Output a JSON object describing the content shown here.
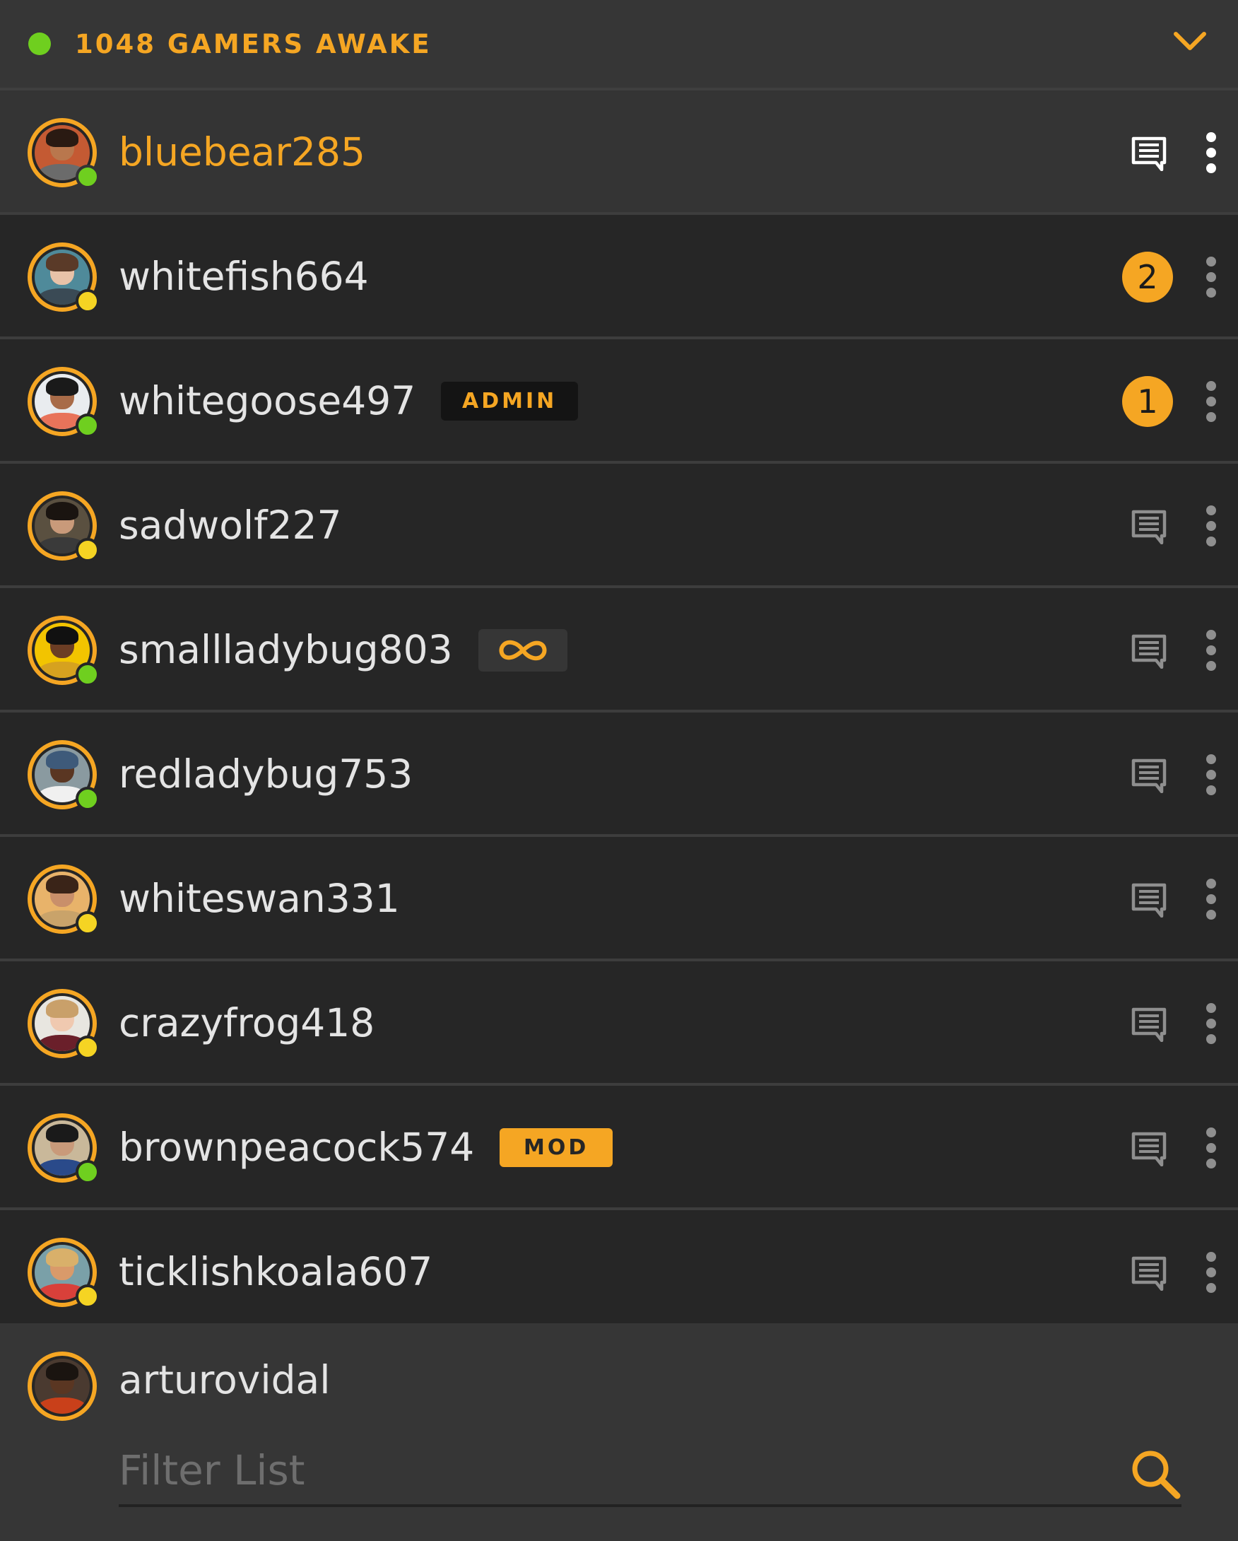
{
  "header": {
    "online_count_label": "1048 GAMERS AWAKE",
    "online_dot_color": "#6fcf1f",
    "collapse_icon": "chevron-down-icon"
  },
  "colors": {
    "accent": "#f5a623",
    "online": "#6fcf1f",
    "away": "#f5d423"
  },
  "users": [
    {
      "name": "bluebear285",
      "self": true,
      "status": "online",
      "action": "chat",
      "skin": "#b9774d",
      "hair": "#2a1a12",
      "shirt": "#6b6b6b",
      "bg": "#c45a33"
    },
    {
      "name": "whitefish664",
      "status": "away",
      "unread": "2",
      "skin": "#e8c2a8",
      "hair": "#5a3a28",
      "shirt": "#3a4a55",
      "bg": "#4f8a9a"
    },
    {
      "name": "whitegoose497",
      "status": "online",
      "badge": "ADMIN",
      "badge_type": "admin",
      "unread": "1",
      "skin": "#a86b48",
      "hair": "#1a1a1a",
      "shirt": "#e8735a",
      "bg": "#e9ecef"
    },
    {
      "name": "sadwolf227",
      "status": "away",
      "action": "chat",
      "skin": "#c99a7a",
      "hair": "#1a1410",
      "shirt": "#3a3a3a",
      "bg": "#5a5040"
    },
    {
      "name": "smallladybug803",
      "status": "online",
      "badge_type": "infinity",
      "action": "chat",
      "skin": "#6b3d24",
      "hair": "#111111",
      "shirt": "#d6a21f",
      "bg": "#f2c400"
    },
    {
      "name": "redladybug753",
      "status": "online",
      "action": "chat",
      "skin": "#5a3622",
      "hair": "#3e5a7a",
      "shirt": "#f0f0f0",
      "bg": "#8a9aa0"
    },
    {
      "name": "whiteswan331",
      "status": "away",
      "action": "chat",
      "skin": "#c98f6a",
      "hair": "#3a2418",
      "shirt": "#c9a36a",
      "bg": "#e8b36a"
    },
    {
      "name": "crazyfrog418",
      "status": "away",
      "action": "chat",
      "skin": "#f0c9b0",
      "hair": "#c9a06a",
      "shirt": "#6a1f2a",
      "bg": "#e8e6e0"
    },
    {
      "name": "brownpeacock574",
      "status": "online",
      "badge": "MOD",
      "badge_type": "mod",
      "action": "chat",
      "skin": "#c99a7a",
      "hair": "#1a1a1a",
      "shirt": "#2a4a8a",
      "bg": "#c9b89a"
    },
    {
      "name": "ticklishkoala607",
      "status": "away",
      "action": "chat",
      "skin": "#d99a6a",
      "hair": "#d9b06a",
      "shirt": "#d9403a",
      "bg": "#7aa0a8"
    }
  ],
  "footer": {
    "current_user": "arturovidal",
    "avatar": {
      "skin": "#5a3622",
      "hair": "#1a1410",
      "shirt": "#c9401a",
      "bg": "#4a3a30"
    },
    "filter_placeholder": "Filter List",
    "search_icon": "search-icon"
  }
}
